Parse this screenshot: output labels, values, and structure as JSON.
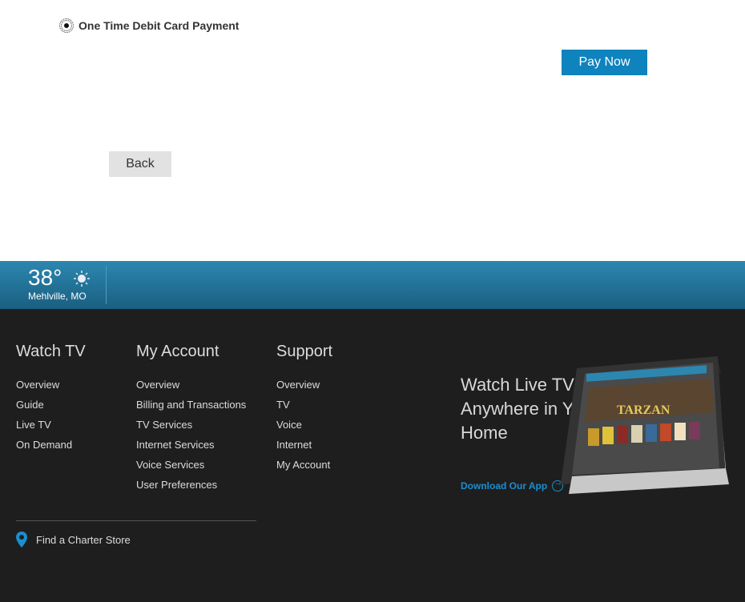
{
  "payment": {
    "option_label": "One Time Debit Card Payment",
    "pay_now_label": "Pay Now",
    "back_label": "Back"
  },
  "weather": {
    "temperature": "38°",
    "location": "Mehlville, MO",
    "icon": "sun-icon"
  },
  "footer": {
    "watch_tv": {
      "title": "Watch TV",
      "links": [
        "Overview",
        "Guide",
        "Live TV",
        "On Demand"
      ]
    },
    "my_account": {
      "title": "My Account",
      "links": [
        "Overview",
        "Billing and Transactions",
        "TV Services",
        "Internet Services",
        "Voice Services",
        "User Preferences"
      ]
    },
    "support": {
      "title": "Support",
      "links": [
        "Overview",
        "TV",
        "Voice",
        "Internet",
        "My Account"
      ]
    },
    "store_label": "Find a Charter Store",
    "promo": {
      "title": "Watch Live TV Anywhere in Your Home",
      "link": "Download Our App",
      "tablet_text": "TARZAN"
    }
  },
  "colors": {
    "accent": "#0e83bd",
    "footer_bg": "#1e1e1e",
    "weather_bar": "#2c87b0",
    "link_blue": "#1a8fd0"
  }
}
